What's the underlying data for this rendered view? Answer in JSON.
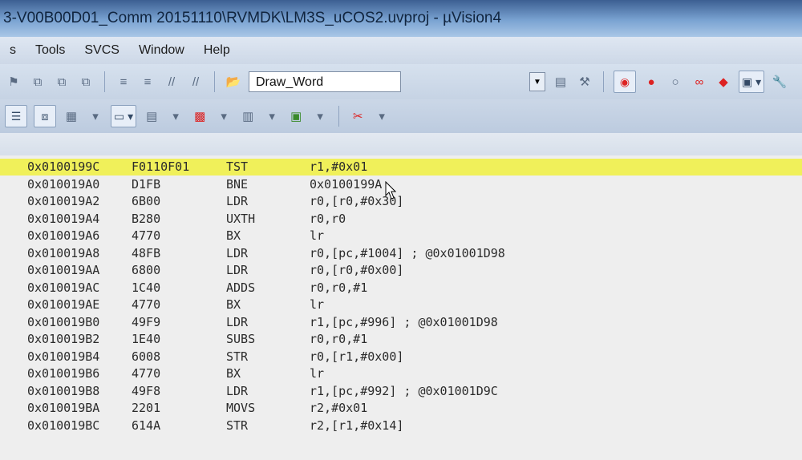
{
  "window": {
    "title": "3-V00B00D01_Comm 20151110\\RVMDK\\LM3S_uCOS2.uvproj - µVision4"
  },
  "menu": {
    "items": [
      "s",
      "Tools",
      "SVCS",
      "Window",
      "Help"
    ]
  },
  "toolbar": {
    "target_combo_value": "Draw_Word"
  },
  "disassembly": {
    "rows": [
      {
        "addr": "0x0100199C",
        "opcode": "F0110F01",
        "mnemonic": "TST",
        "args": "r1,#0x01"
      },
      {
        "addr": "0x010019A0",
        "opcode": "D1FB",
        "mnemonic": "BNE",
        "args": "0x0100199A"
      },
      {
        "addr": "0x010019A2",
        "opcode": "6B00",
        "mnemonic": "LDR",
        "args": "r0,[r0,#0x30]"
      },
      {
        "addr": "0x010019A4",
        "opcode": "B280",
        "mnemonic": "UXTH",
        "args": "r0,r0"
      },
      {
        "addr": "0x010019A6",
        "opcode": "4770",
        "mnemonic": "BX",
        "args": "lr"
      },
      {
        "addr": "0x010019A8",
        "opcode": "48FB",
        "mnemonic": "LDR",
        "args": "r0,[pc,#1004]  ; @0x01001D98"
      },
      {
        "addr": "0x010019AA",
        "opcode": "6800",
        "mnemonic": "LDR",
        "args": "r0,[r0,#0x00]"
      },
      {
        "addr": "0x010019AC",
        "opcode": "1C40",
        "mnemonic": "ADDS",
        "args": "r0,r0,#1"
      },
      {
        "addr": "0x010019AE",
        "opcode": "4770",
        "mnemonic": "BX",
        "args": "lr"
      },
      {
        "addr": "0x010019B0",
        "opcode": "49F9",
        "mnemonic": "LDR",
        "args": "r1,[pc,#996]  ; @0x01001D98"
      },
      {
        "addr": "0x010019B2",
        "opcode": "1E40",
        "mnemonic": "SUBS",
        "args": "r0,r0,#1"
      },
      {
        "addr": "0x010019B4",
        "opcode": "6008",
        "mnemonic": "STR",
        "args": "r0,[r1,#0x00]"
      },
      {
        "addr": "0x010019B6",
        "opcode": "4770",
        "mnemonic": "BX",
        "args": "lr"
      },
      {
        "addr": "0x010019B8",
        "opcode": "49F8",
        "mnemonic": "LDR",
        "args": "r1,[pc,#992]  ; @0x01001D9C"
      },
      {
        "addr": "0x010019BA",
        "opcode": "2201",
        "mnemonic": "MOVS",
        "args": "r2,#0x01"
      },
      {
        "addr": "0x010019BC",
        "opcode": "614A",
        "mnemonic": "STR",
        "args": "r2,[r1,#0x14]"
      }
    ]
  },
  "colors": {
    "current_line": "#f0f05a",
    "code_bg": "#eeeeee"
  }
}
